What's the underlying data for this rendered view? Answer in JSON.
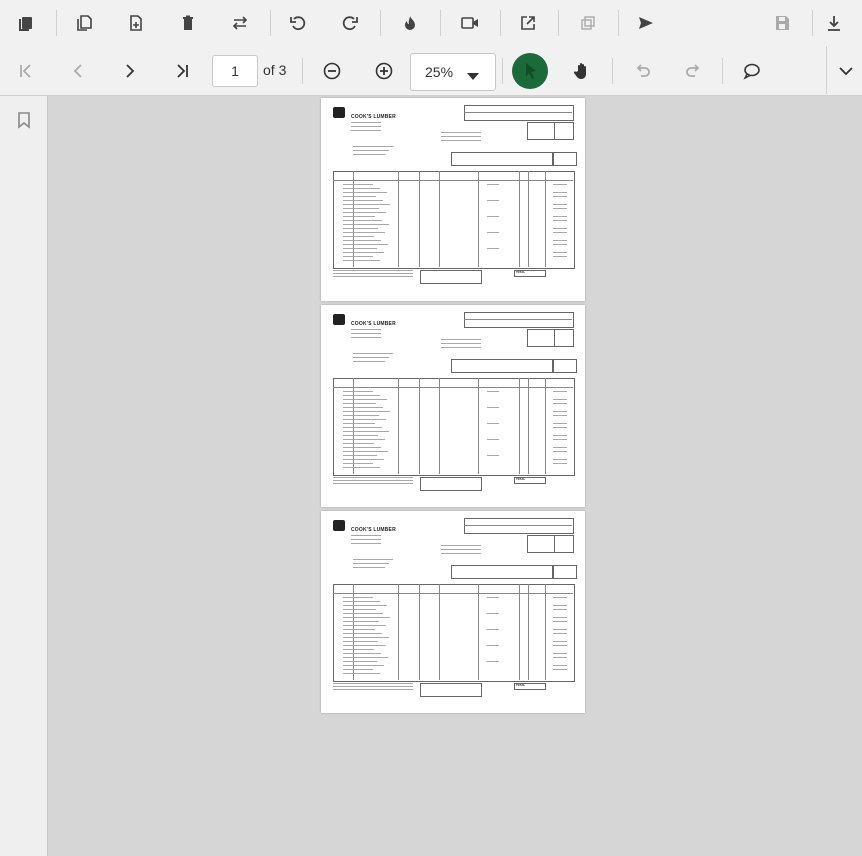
{
  "toolbar_top": {
    "icons": [
      "copy-pages-icon",
      "copy-file-icon",
      "add-file-icon",
      "delete-icon",
      "swap-icon",
      "undo-rotate-icon",
      "redo-rotate-icon",
      "flame-icon",
      "video-icon",
      "open-external-icon",
      "stack-icon",
      "send-icon",
      "save-icon",
      "download-icon"
    ]
  },
  "toolbar_nav": {
    "current_page": "1",
    "page_count_label": "of 3",
    "zoom_label": "25%"
  },
  "document": {
    "company": "COOK'S LUMBER",
    "total_label": "TOTAL",
    "pages": 3
  },
  "colors": {
    "toolbar_bg": "#f1f1f1",
    "viewer_bg": "#d6d6d6",
    "accent_green": "#1b6b3a"
  }
}
